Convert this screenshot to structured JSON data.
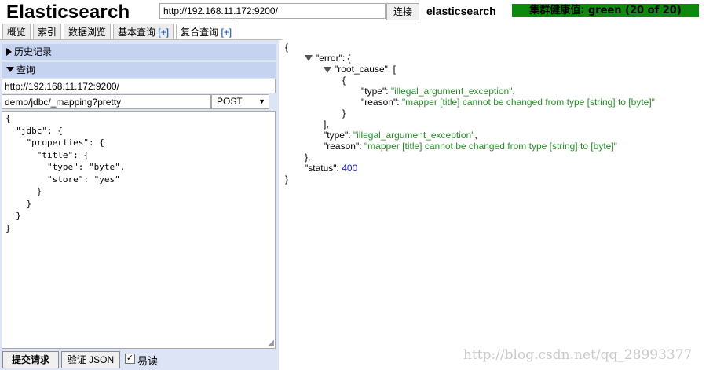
{
  "header": {
    "logo": "Elasticsearch",
    "url_value": "http://192.168.11.172:9200/",
    "connect_label": "连接",
    "cluster_name": "elasticsearch",
    "health_label": "集群健康值: green (20 of 20)",
    "health_color": "#0d8a0d"
  },
  "tabs": [
    {
      "label": "概览",
      "plus": ""
    },
    {
      "label": "索引",
      "plus": ""
    },
    {
      "label": "数据浏览",
      "plus": ""
    },
    {
      "label": "基本查询",
      "plus": "[+]"
    },
    {
      "label": "复合查询",
      "plus": "[+]"
    }
  ],
  "left": {
    "history_label": "历史记录",
    "query_label": "查询",
    "server_value": "http://192.168.11.172:9200/",
    "path_value": "demo/jdbc/_mapping?pretty",
    "method_value": "POST",
    "body_text": "{\n  \"jdbc\": {\n    \"properties\": {\n      \"title\": {\n        \"type\": \"byte\",\n        \"store\": \"yes\"\n      }\n    }\n  }\n}",
    "submit_label": "提交请求",
    "validate_label": "验证 JSON",
    "readonly_label": "易读",
    "readonly_checked": "✓"
  },
  "response": {
    "open_brace": "{",
    "error_key": "\"error\"",
    "root_cause_key": "\"root_cause\"",
    "type_key": "\"type\"",
    "reason_key": "\"reason\"",
    "status_key": "\"status\"",
    "type_value": "\"illegal_argument_exception\"",
    "reason_value": "\"mapper [title] cannot be changed from type [string] to [byte]\"",
    "status_value": "400",
    "close_brace": "}"
  },
  "watermark": "http://blog.csdn.net/qq_28993377"
}
